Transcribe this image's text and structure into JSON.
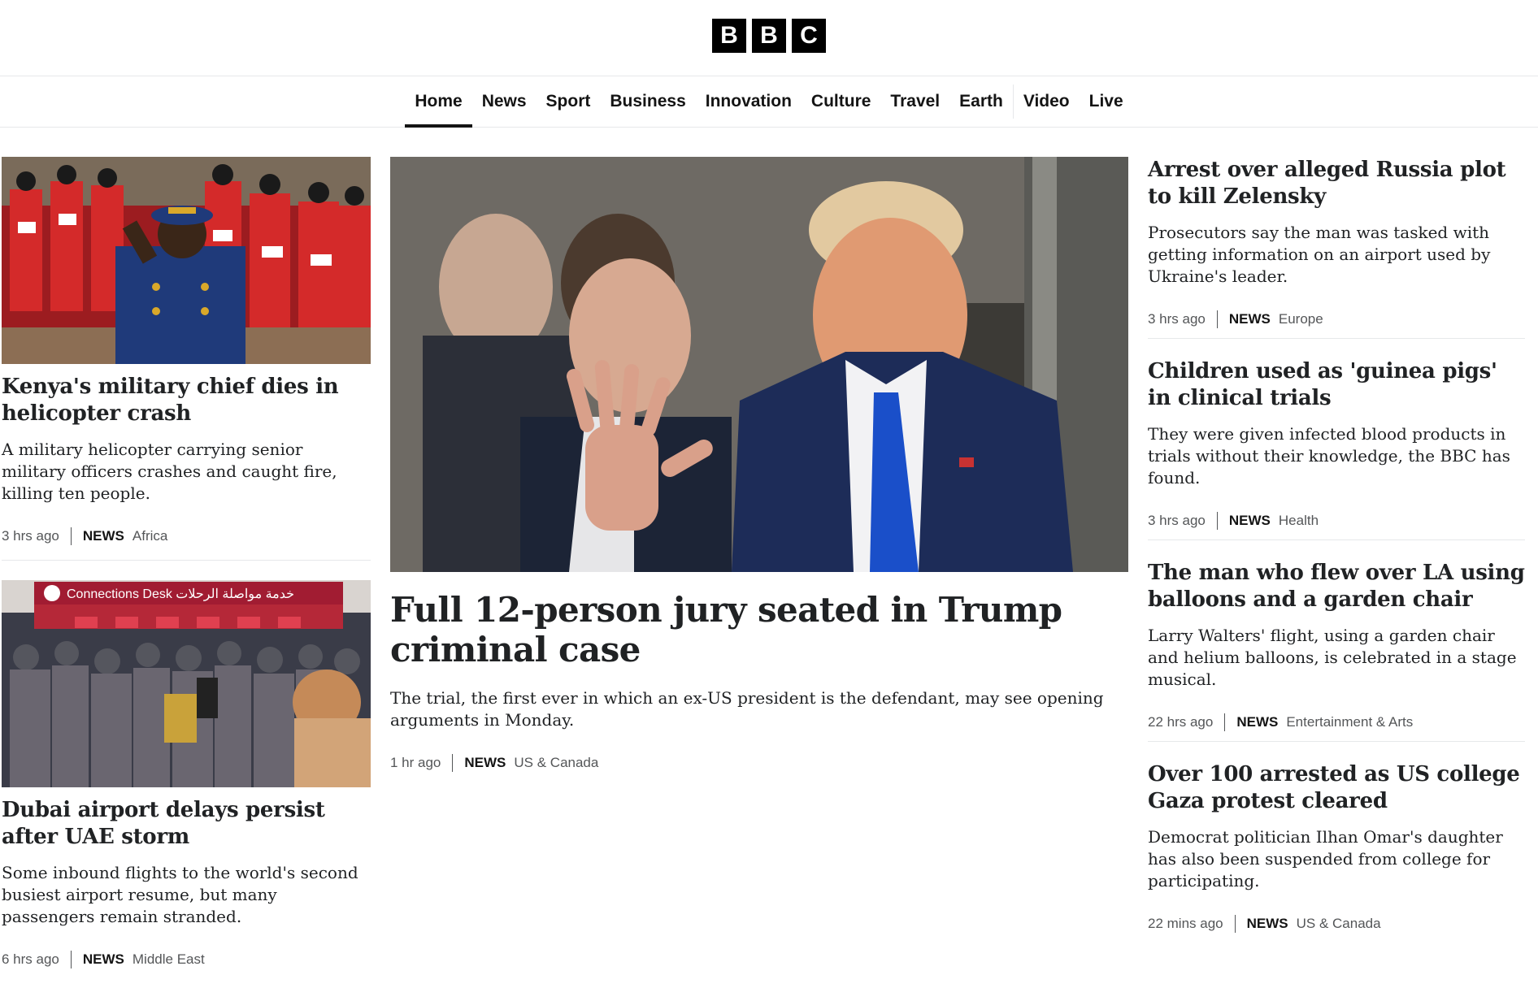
{
  "logo": {
    "letters": [
      "B",
      "B",
      "C"
    ]
  },
  "nav": {
    "items": [
      {
        "label": "Home",
        "active": true
      },
      {
        "label": "News"
      },
      {
        "label": "Sport"
      },
      {
        "label": "Business"
      },
      {
        "label": "Innovation"
      },
      {
        "label": "Culture"
      },
      {
        "label": "Travel"
      },
      {
        "label": "Earth"
      },
      {
        "label": "Video"
      },
      {
        "label": "Live"
      }
    ]
  },
  "left": {
    "stories": [
      {
        "headline": "Kenya's military chief dies in helicopter crash",
        "summary": "A military helicopter carrying senior military officers crashes and caught fire, killing ten people.",
        "time": "3 hrs ago",
        "label": "NEWS",
        "category": "Africa"
      },
      {
        "headline": "Dubai airport delays persist after UAE storm",
        "summary": "Some inbound flights to the world's second busiest airport resume, but many passengers remain stranded.",
        "time": "6 hrs ago",
        "label": "NEWS",
        "category": "Middle East",
        "image_sign": "Connections Desk  خدمة مواصلة الرحلات"
      }
    ]
  },
  "center": {
    "headline": "Full 12-person jury seated in Trump criminal case",
    "summary": "The trial, the first ever in which an ex-US president is the defendant, may see opening arguments in Monday.",
    "time": "1 hr ago",
    "label": "NEWS",
    "category": "US & Canada"
  },
  "right": {
    "stories": [
      {
        "headline": "Arrest over alleged Russia plot to kill Zelensky",
        "summary": "Prosecutors say the man was tasked with getting information on an airport used by Ukraine's leader.",
        "time": "3 hrs ago",
        "label": "NEWS",
        "category": "Europe"
      },
      {
        "headline": "Children used as 'guinea pigs' in clinical trials",
        "summary": "They were given infected blood products in trials without their knowledge, the BBC has found.",
        "time": "3 hrs ago",
        "label": "NEWS",
        "category": "Health"
      },
      {
        "headline": "The man who flew over LA using balloons and a garden chair",
        "summary": "Larry Walters' flight, using a garden chair and helium balloons, is celebrated in a stage musical.",
        "time": "22 hrs ago",
        "label": "NEWS",
        "category": "Entertainment & Arts"
      },
      {
        "headline": "Over 100 arrested as US college Gaza protest cleared",
        "summary": "Democrat politician Ilhan Omar's daughter has also been suspended from college for participating.",
        "time": "22 mins ago",
        "label": "NEWS",
        "category": "US & Canada"
      }
    ]
  }
}
